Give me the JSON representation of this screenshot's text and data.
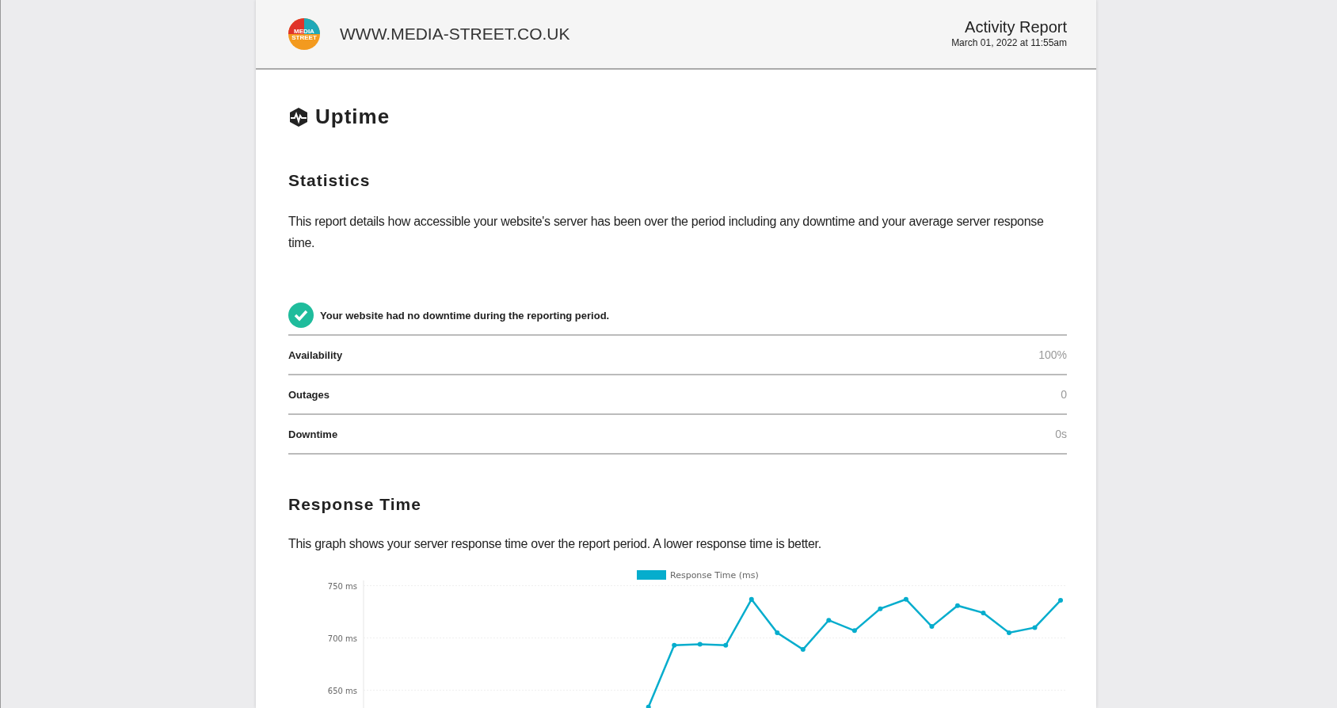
{
  "header": {
    "site": "WWW.MEDIA-STREET.CO.UK",
    "logo_text": "MEDIA STREET",
    "report_title": "Activity Report",
    "report_date": "March 01, 2022 at 11:55am"
  },
  "section": {
    "title": "Uptime"
  },
  "statistics": {
    "title": "Statistics",
    "description": "This report details how accessible your website's server has been over the period including any downtime and your average server response time.",
    "status": {
      "ok": true,
      "message": "Your website had no downtime during the reporting period."
    },
    "rows": [
      {
        "label": "Availability",
        "value": "100%"
      },
      {
        "label": "Outages",
        "value": "0"
      },
      {
        "label": "Downtime",
        "value": "0s"
      }
    ]
  },
  "response_time": {
    "title": "Response Time",
    "description": "This graph shows your server response time over the report period. A lower response time is better.",
    "chart_data": {
      "type": "line",
      "ylim": [
        632,
        755
      ],
      "grid": true,
      "yticks": [
        {
          "value": 650,
          "label": "650 ms"
        },
        {
          "value": 700,
          "label": "700 ms"
        },
        {
          "value": 750,
          "label": "750 ms"
        }
      ],
      "series": [
        {
          "name": "Response Time (ms)",
          "color": "#06adcd",
          "marker": "circle",
          "values": [
            null,
            null,
            null,
            null,
            null,
            null,
            null,
            null,
            null,
            null,
            null,
            634,
            693,
            694,
            693,
            737,
            705,
            689,
            717,
            707,
            728,
            737,
            711,
            731,
            724,
            705,
            710,
            736
          ]
        }
      ]
    }
  }
}
